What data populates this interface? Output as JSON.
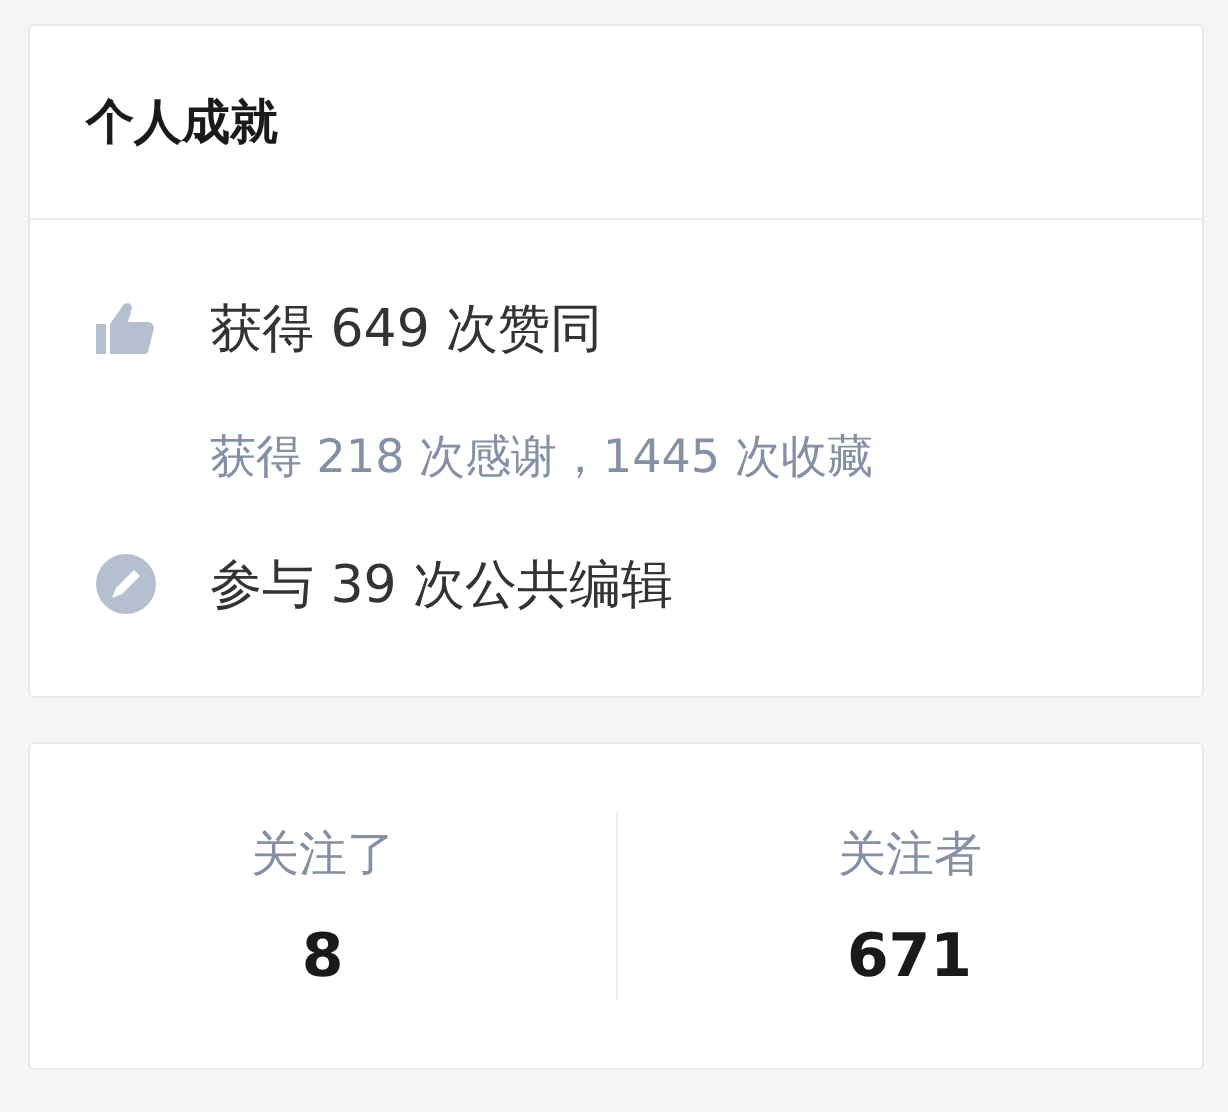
{
  "achievements": {
    "title": "个人成就",
    "items": [
      {
        "kind": "likes",
        "text": "获得 649 次赞同"
      },
      {
        "kind": "detail",
        "text": "获得 218 次感谢，1445 次收藏"
      },
      {
        "kind": "edits",
        "text": "参与 39 次公共编辑"
      }
    ]
  },
  "follow_stats": [
    {
      "label": "关注了",
      "count": "8"
    },
    {
      "label": "关注者",
      "count": "671"
    }
  ]
}
